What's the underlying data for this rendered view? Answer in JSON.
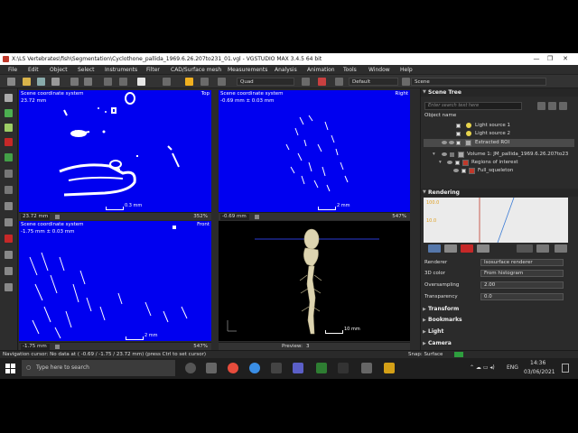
{
  "window": {
    "title": "X:\\LS Vertebrates\\fish\\Segmentation\\Cyclothone_pallida_1969.6.26.207to231_01.vgl - VGSTUDIO MAX 3.4.5 64 bit"
  },
  "menu": [
    "File",
    "Edit",
    "Object",
    "Select",
    "Instruments",
    "Filter",
    "CAD/Surface mesh",
    "Measurements",
    "Analysis",
    "Animation",
    "Tools",
    "Window",
    "Help"
  ],
  "toolbar": {
    "layout_label": "Quad",
    "display_label": "Default",
    "scene_label": "Scene"
  },
  "viewports": {
    "top": {
      "title": "Scene coordinate system",
      "position": "23.72 mm",
      "corner": "Top",
      "slice_value": "23.72 mm",
      "zoom": "352%",
      "scale": "0.3 mm"
    },
    "right": {
      "title": "Scene coordinate system",
      "position": "-0.69 mm ± 0.03 mm",
      "corner": "Right",
      "slice_value": "-0.69 mm",
      "zoom": "547%",
      "scale": "2 mm"
    },
    "front": {
      "title": "Scene coordinate system",
      "position": "-1.75 mm ± 0.03 mm",
      "corner": "Front",
      "slice_value": "-1.75 mm",
      "zoom": "547%",
      "scale": "2 mm"
    },
    "preview": {
      "preview_label": "Preview:",
      "preview_value": "3",
      "scale": "10 mm"
    }
  },
  "scene_tree": {
    "header": "Scene Tree",
    "search_placeholder": "Enter search text here",
    "column_label": "Object name",
    "items": [
      {
        "label": "Light source 1"
      },
      {
        "label": "Light source 2"
      },
      {
        "label": "Extracted ROI"
      },
      {
        "label": "Volume 1: JM_pallida_1969.6.26.207to23"
      },
      {
        "label": "Regions of interest"
      },
      {
        "label": "Full_squeleton"
      }
    ]
  },
  "rendering": {
    "header": "Rendering",
    "graph_labels": [
      "100.0",
      "10.0"
    ],
    "props": [
      {
        "label": "Renderer",
        "value": "Isosurface renderer"
      },
      {
        "label": "3D color",
        "value": "From histogram"
      },
      {
        "label": "Oversampling",
        "value": "2.00"
      },
      {
        "label": "Transparency",
        "value": "0.0"
      }
    ],
    "sections": [
      "Transform",
      "Bookmarks",
      "Light",
      "Camera"
    ]
  },
  "statusbar": {
    "text": "Navigation cursor: No data at ( -0.69 / -1.75 / 23.72 mm) (press Ctrl to set cursor)",
    "snap": "Snap: Surface"
  },
  "taskbar": {
    "search_placeholder": "Type here to search",
    "language": "ENG",
    "time": "14:36",
    "date": "03/06/2021"
  },
  "colors": {
    "viewport_blue": "#0000f0",
    "accent_red": "#c0392b"
  }
}
